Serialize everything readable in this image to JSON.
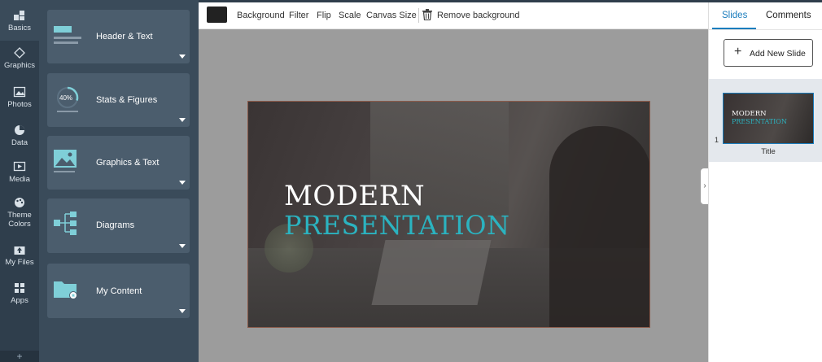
{
  "rail": {
    "items": [
      {
        "label": "Basics",
        "icon": "basics-icon"
      },
      {
        "label": "Graphics",
        "icon": "graphics-icon"
      },
      {
        "label": "Photos",
        "icon": "photos-icon"
      },
      {
        "label": "Data",
        "icon": "pie-chart-icon"
      },
      {
        "label": "Media",
        "icon": "media-icon"
      },
      {
        "label": "Theme Colors",
        "icon": "palette-icon"
      },
      {
        "label": "My Files",
        "icon": "upload-icon"
      },
      {
        "label": "Apps",
        "icon": "apps-grid-icon"
      }
    ],
    "bottom": "+"
  },
  "panel": {
    "cards": [
      {
        "label": "Header & Text"
      },
      {
        "label": "Stats & Figures",
        "badge": "40%"
      },
      {
        "label": "Graphics & Text"
      },
      {
        "label": "Diagrams"
      },
      {
        "label": "My Content"
      }
    ]
  },
  "toolbar": {
    "background": "Background",
    "filter": "Filter",
    "flip": "Flip",
    "scale": "Scale",
    "canvas_size": "Canvas Size",
    "remove_bg": "Remove background"
  },
  "slide": {
    "title_line1": "MODERN",
    "title_line2": "PRESENTATION"
  },
  "right_panel": {
    "tabs": {
      "slides": "Slides",
      "comments": "Comments"
    },
    "add_button": "Add New Slide",
    "slides": [
      {
        "number": "1",
        "name": "Title",
        "thumb_line1": "MODERN",
        "thumb_line2": "PRESENTATION"
      }
    ],
    "collapse": "›"
  },
  "colors": {
    "accent": "#2bb3c0",
    "tab_active": "#1a7dbd",
    "rail_bg": "#2f3e4c",
    "panel_bg": "#3a4b5a",
    "card_bg": "#4b5d6d"
  }
}
